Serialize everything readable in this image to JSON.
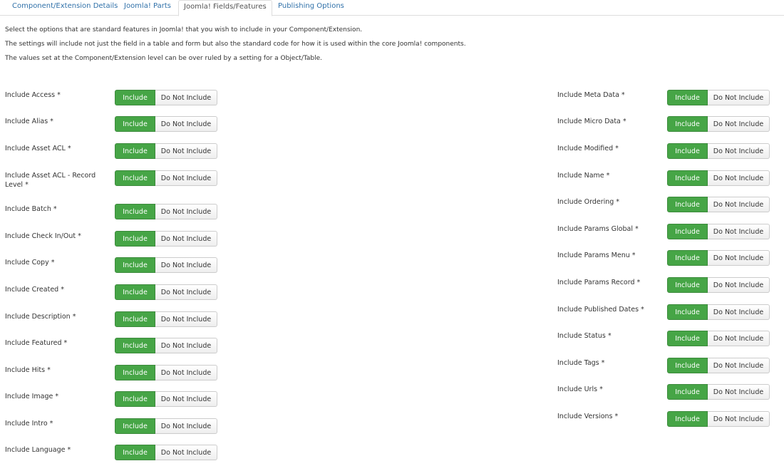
{
  "tabs": [
    {
      "label": "Component/Extension Details",
      "active": false
    },
    {
      "label": "Joomla! Parts",
      "active": false
    },
    {
      "label": "Joomla! Fields/Features",
      "active": true
    },
    {
      "label": "Publishing Options",
      "active": false
    }
  ],
  "description": [
    "Select the options that are standard features in Joomla! that you wish to include in your Component/Extension.",
    "The settings will include not just the field in a table and form but also the standard code for how it is used within the core Joomla! components.",
    "The values set at the Component/Extension level can be over ruled by a setting for a Object/Table."
  ],
  "toggle": {
    "include_label": "Include",
    "exclude_label": "Do Not Include",
    "selected": "Include"
  },
  "left_fields": [
    {
      "label": "Include Access *"
    },
    {
      "label": "Include Alias *"
    },
    {
      "label": "Include Asset ACL *"
    },
    {
      "label": "Include Asset ACL - Record Level *"
    },
    {
      "label": "Include Batch *"
    },
    {
      "label": "Include Check In/Out *"
    },
    {
      "label": "Include Copy *"
    },
    {
      "label": "Include Created *"
    },
    {
      "label": "Include Description *"
    },
    {
      "label": "Include Featured *"
    },
    {
      "label": "Include Hits *"
    },
    {
      "label": "Include Image *"
    },
    {
      "label": "Include Intro *"
    },
    {
      "label": "Include Language *"
    }
  ],
  "right_fields": [
    {
      "label": "Include Meta Data *"
    },
    {
      "label": "Include Micro Data *"
    },
    {
      "label": "Include Modified *"
    },
    {
      "label": "Include Name *"
    },
    {
      "label": "Include Ordering *"
    },
    {
      "label": "Include Params Global *"
    },
    {
      "label": "Include Params Menu *"
    },
    {
      "label": "Include Params Record *"
    },
    {
      "label": "Include Published Dates *"
    },
    {
      "label": "Include Status *"
    },
    {
      "label": "Include Tags *"
    },
    {
      "label": "Include Urls *"
    },
    {
      "label": "Include Versions *"
    }
  ]
}
